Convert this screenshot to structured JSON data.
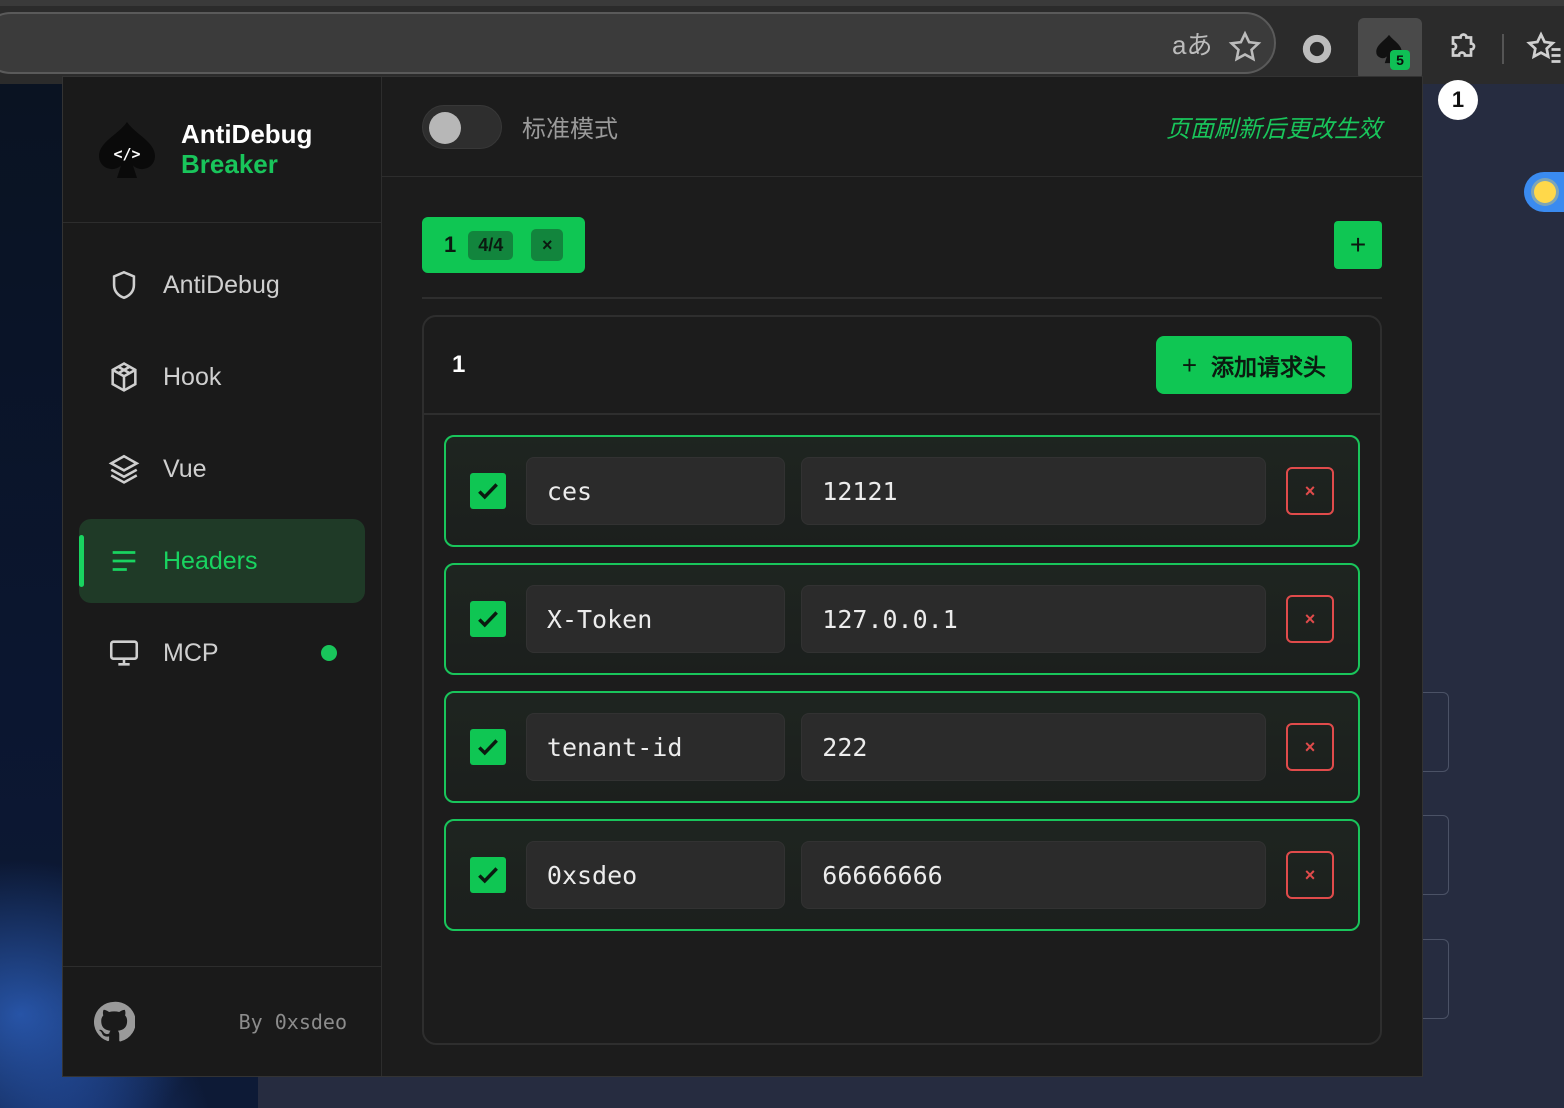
{
  "browser": {
    "translate_icon": "translate-icon",
    "bookmark_icon": "star-icon",
    "record_icon": "record-icon",
    "extension_badge": "5",
    "extensions_icon": "puzzle-icon",
    "favorites_icon": "favorites-icon",
    "notification_count": "1"
  },
  "brand": {
    "line1": "AntiDebug",
    "line2": "Breaker",
    "accent": "#19c55b"
  },
  "sidebar": {
    "items": [
      {
        "label": "AntiDebug",
        "icon": "shield-icon"
      },
      {
        "label": "Hook",
        "icon": "cube-icon"
      },
      {
        "label": "Vue",
        "icon": "layers-icon"
      },
      {
        "label": "Headers",
        "icon": "list-icon",
        "active": true
      },
      {
        "label": "MCP",
        "icon": "monitor-icon",
        "status": "online"
      }
    ],
    "footer_icon": "github-icon",
    "footer_text": "By 0xsdeo"
  },
  "topbar": {
    "mode_label": "标准模式",
    "mode_enabled": false,
    "refresh_note": "页面刷新后更改生效"
  },
  "tabs": [
    {
      "name": "1",
      "count": "4/4",
      "close": "×"
    }
  ],
  "add_tab_label": "+",
  "panel": {
    "title": "1",
    "add_header_plus": "+",
    "add_header_label": "添加请求头"
  },
  "headers": [
    {
      "enabled": true,
      "name": "ces",
      "value": "12121"
    },
    {
      "enabled": true,
      "name": "X-Token",
      "value": "127.0.0.1"
    },
    {
      "enabled": true,
      "name": "tenant-id",
      "value": "222"
    },
    {
      "enabled": true,
      "name": "0xsdeo",
      "value": "66666666"
    }
  ],
  "delete_label": "×"
}
